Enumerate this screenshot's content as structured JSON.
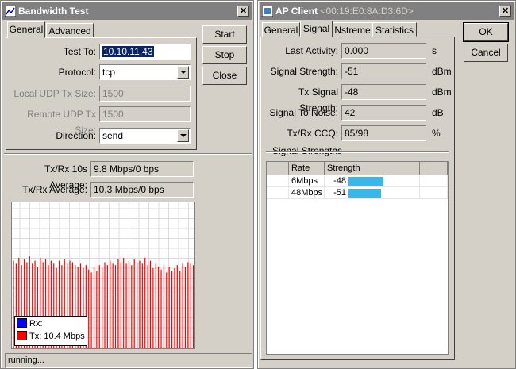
{
  "bw": {
    "title": "Bandwidth Test",
    "tabs": [
      "General",
      "Advanced"
    ],
    "fields": {
      "test_to": {
        "label": "Test To:",
        "value": "10.10.11.43"
      },
      "protocol": {
        "label": "Protocol:",
        "value": "tcp"
      },
      "local_udp": {
        "label": "Local UDP Tx Size:",
        "value": "1500"
      },
      "remote_udp": {
        "label": "Remote UDP Tx Size:",
        "value": "1500"
      },
      "direction": {
        "label": "Direction:",
        "value": "send"
      }
    },
    "buttons": {
      "start": "Start",
      "stop": "Stop",
      "close": "Close"
    },
    "avg10": {
      "label": "Tx/Rx 10s Average:",
      "value": "9.8 Mbps/0 bps"
    },
    "avg": {
      "label": "Tx/Rx Average:",
      "value": "10.3 Mbps/0 bps"
    },
    "legend": {
      "rx": "Rx:",
      "tx": "Tx: 10.4 Mbps"
    },
    "status": "running...",
    "graph": {
      "tx_levels": [
        0.6,
        0.58,
        0.62,
        0.57,
        0.61,
        0.59,
        0.63,
        0.58,
        0.6,
        0.56,
        0.62,
        0.59,
        0.61,
        0.57,
        0.6,
        0.58,
        0.55,
        0.6,
        0.57,
        0.61,
        0.58,
        0.6,
        0.59,
        0.57,
        0.56,
        0.58,
        0.55,
        0.57,
        0.54,
        0.52,
        0.56,
        0.53,
        0.57,
        0.55,
        0.59,
        0.57,
        0.6,
        0.58,
        0.57,
        0.61,
        0.59,
        0.62,
        0.58,
        0.6,
        0.57,
        0.61,
        0.59,
        0.6,
        0.58,
        0.62,
        0.57,
        0.6,
        0.55,
        0.58,
        0.56,
        0.54,
        0.57,
        0.52,
        0.56,
        0.53,
        0.55,
        0.57,
        0.53,
        0.58,
        0.56,
        0.59,
        0.58,
        0.57
      ]
    },
    "colors": {
      "rx": "#0000ff",
      "tx": "#ff0000"
    }
  },
  "ap": {
    "title": "AP Client",
    "subtitle": "<00:19:E0:8A:D3:6D>",
    "tabs": [
      "General",
      "Signal",
      "Nstreme",
      "Statistics"
    ],
    "fields": [
      {
        "label": "Last Activity:",
        "value": "0.000",
        "unit": "s"
      },
      {
        "label": "Signal Strength:",
        "value": "-51",
        "unit": "dBm"
      },
      {
        "label": "Tx Signal Strength:",
        "value": "-48",
        "unit": "dBm"
      },
      {
        "label": "Signal To Noise:",
        "value": "42",
        "unit": "dB"
      },
      {
        "label": "Tx/Rx CCQ:",
        "value": "85/98",
        "unit": "%"
      }
    ],
    "buttons": {
      "ok": "OK",
      "cancel": "Cancel"
    },
    "group_title": "Signal Strengths",
    "table": {
      "headers": [
        "Rate",
        "Strength"
      ],
      "rows": [
        {
          "rate": "6Mbps",
          "strength": "-48",
          "level": 0.48
        },
        {
          "rate": "48Mbps",
          "strength": "-51",
          "level": 0.45
        }
      ]
    },
    "bar_color": "#39b6ea"
  }
}
